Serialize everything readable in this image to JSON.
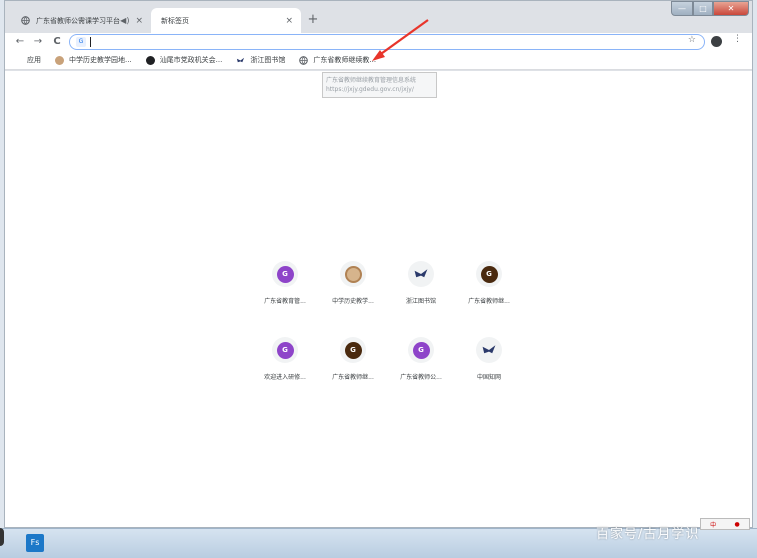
{
  "tabs": [
    {
      "title": "广东省教师公需课学习平台",
      "icon": "globe-icon",
      "mute_icon": "speaker-icon",
      "close": "×"
    },
    {
      "title": "新标签页",
      "close": "×"
    }
  ],
  "newtab_label": "+",
  "window_controls": {
    "min": "—",
    "max": "□",
    "close": "✕"
  },
  "nav": {
    "back": "←",
    "forward": "→",
    "reload": "C"
  },
  "omnibox": {
    "value": "",
    "search_glyph": "G",
    "star": "☆",
    "menu": "⋮"
  },
  "bookmarks": [
    {
      "label": "应用",
      "icon": "apps-grid-icon"
    },
    {
      "label": "中学历史教学园地...",
      "icon": "history-site-icon"
    },
    {
      "label": "汕尾市党政机关会...",
      "icon": "black-circle-icon"
    },
    {
      "label": "浙江图书馆",
      "icon": "library-icon"
    },
    {
      "label": "广东省教师继续教...",
      "icon": "globe-icon"
    }
  ],
  "tooltip": {
    "title": "广东省教师继续教育管理信息系统",
    "url": "https://jxjy.gdedu.gov.cn/jxjy/"
  },
  "shortcuts": [
    {
      "label": "广东省教育管...",
      "glyph": "G",
      "color": "#8e44c9"
    },
    {
      "label": "中学历史教学...",
      "glyph": "",
      "color": "#c9a27a"
    },
    {
      "label": "浙江图书馆",
      "glyph": "",
      "color": "#2b3a6b"
    },
    {
      "label": "广东省教师继...",
      "glyph": "G",
      "color": "#4a2a0f"
    },
    {
      "label": "欢迎进入研修...",
      "glyph": "G",
      "color": "#8e44c9"
    },
    {
      "label": "广东省教师继...",
      "glyph": "G",
      "color": "#4a2a0f"
    },
    {
      "label": "广东省教师公...",
      "glyph": "G",
      "color": "#8e44c9"
    },
    {
      "label": "中国知网",
      "glyph": "",
      "color": "#2b3a6b"
    }
  ],
  "taskbar": {
    "app_label": "Fs",
    "tray_text": "中",
    "watermark": "百家号/古月学识"
  },
  "colors": {
    "accent": "#1a73e8",
    "arrow": "#e8352b"
  }
}
